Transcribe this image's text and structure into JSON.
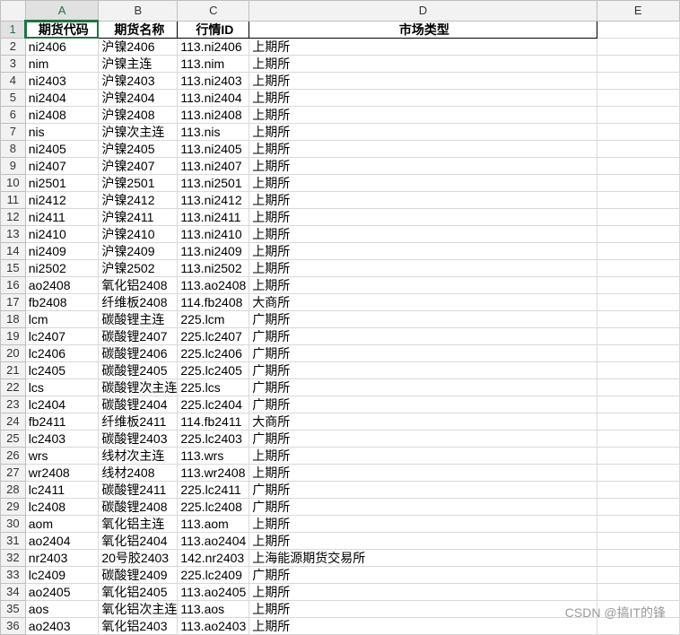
{
  "columns": [
    "A",
    "B",
    "C",
    "D",
    "E"
  ],
  "header": [
    "期货代码",
    "期货名称",
    "行情ID",
    "市场类型"
  ],
  "rows": [
    [
      "ni2406",
      "沪镍2406",
      "113.ni2406",
      "上期所"
    ],
    [
      "nim",
      "沪镍主连",
      "113.nim",
      "上期所"
    ],
    [
      "ni2403",
      "沪镍2403",
      "113.ni2403",
      "上期所"
    ],
    [
      "ni2404",
      "沪镍2404",
      "113.ni2404",
      "上期所"
    ],
    [
      "ni2408",
      "沪镍2408",
      "113.ni2408",
      "上期所"
    ],
    [
      "nis",
      "沪镍次主连",
      "113.nis",
      "上期所"
    ],
    [
      "ni2405",
      "沪镍2405",
      "113.ni2405",
      "上期所"
    ],
    [
      "ni2407",
      "沪镍2407",
      "113.ni2407",
      "上期所"
    ],
    [
      "ni2501",
      "沪镍2501",
      "113.ni2501",
      "上期所"
    ],
    [
      "ni2412",
      "沪镍2412",
      "113.ni2412",
      "上期所"
    ],
    [
      "ni2411",
      "沪镍2411",
      "113.ni2411",
      "上期所"
    ],
    [
      "ni2410",
      "沪镍2410",
      "113.ni2410",
      "上期所"
    ],
    [
      "ni2409",
      "沪镍2409",
      "113.ni2409",
      "上期所"
    ],
    [
      "ni2502",
      "沪镍2502",
      "113.ni2502",
      "上期所"
    ],
    [
      "ao2408",
      "氧化铝2408",
      "113.ao2408",
      "上期所"
    ],
    [
      "fb2408",
      "纤维板2408",
      "114.fb2408",
      "大商所"
    ],
    [
      "lcm",
      "碳酸锂主连",
      "225.lcm",
      "广期所"
    ],
    [
      "lc2407",
      "碳酸锂2407",
      "225.lc2407",
      "广期所"
    ],
    [
      "lc2406",
      "碳酸锂2406",
      "225.lc2406",
      "广期所"
    ],
    [
      "lc2405",
      "碳酸锂2405",
      "225.lc2405",
      "广期所"
    ],
    [
      "lcs",
      "碳酸锂次主连",
      "225.lcs",
      "广期所"
    ],
    [
      "lc2404",
      "碳酸锂2404",
      "225.lc2404",
      "广期所"
    ],
    [
      "fb2411",
      "纤维板2411",
      "114.fb2411",
      "大商所"
    ],
    [
      "lc2403",
      "碳酸锂2403",
      "225.lc2403",
      "广期所"
    ],
    [
      "wrs",
      "线材次主连",
      "113.wrs",
      "上期所"
    ],
    [
      "wr2408",
      "线材2408",
      "113.wr2408",
      "上期所"
    ],
    [
      "lc2411",
      "碳酸锂2411",
      "225.lc2411",
      "广期所"
    ],
    [
      "lc2408",
      "碳酸锂2408",
      "225.lc2408",
      "广期所"
    ],
    [
      "aom",
      "氧化铝主连",
      "113.aom",
      "上期所"
    ],
    [
      "ao2404",
      "氧化铝2404",
      "113.ao2404",
      "上期所"
    ],
    [
      "nr2403",
      "20号胶2403",
      "142.nr2403",
      "上海能源期货交易所"
    ],
    [
      "lc2409",
      "碳酸锂2409",
      "225.lc2409",
      "广期所"
    ],
    [
      "ao2405",
      "氧化铝2405",
      "113.ao2405",
      "上期所"
    ],
    [
      "aos",
      "氧化铝次主连",
      "113.aos",
      "上期所"
    ],
    [
      "ao2403",
      "氧化铝2403",
      "113.ao2403",
      "上期所"
    ]
  ],
  "watermark": "CSDN @搞IT的锋"
}
